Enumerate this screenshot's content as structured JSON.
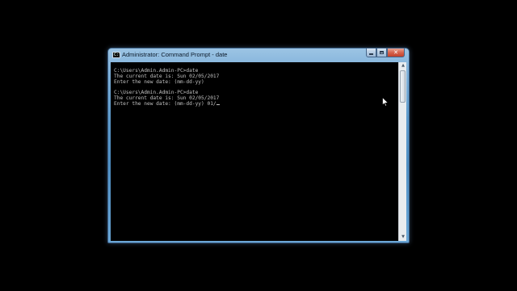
{
  "window": {
    "title": "Administrator: Command Prompt - date",
    "icon_text": "C:\\",
    "caption": {
      "minimize_icon": "minimize-icon",
      "maximize_icon": "maximize-icon",
      "close_label": "✕"
    }
  },
  "console": {
    "lines": [
      "C:\\Users\\Admin.Admin-PC>date",
      "The current date is: Sun 02/05/2017",
      "Enter the new date: (mm-dd-yy)",
      "",
      "C:\\Users\\Admin.Admin-PC>date",
      "The current date is: Sun 02/05/2017",
      "Enter the new date: (mm-dd-yy) 01/"
    ],
    "text_color": "#c0c0c0",
    "background_color": "#000000"
  },
  "scrollbar": {
    "up_arrow": "▲",
    "down_arrow": "▼"
  },
  "desktop": {
    "background_color": "#000000",
    "pointer": "mouse-pointer-icon"
  }
}
